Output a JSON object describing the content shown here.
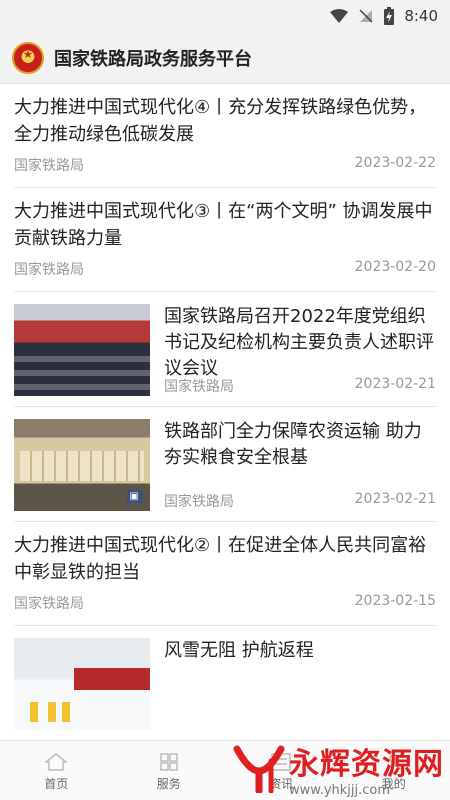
{
  "status": {
    "time": "8:40"
  },
  "app": {
    "title": "国家铁路局政务服务平台"
  },
  "articles": [
    {
      "title": "大力推进中国式现代化④丨充分发挥铁路绿色优势，全力推动绿色低碳发展",
      "source": "国家铁路局",
      "date": "2023-02-22"
    },
    {
      "title": "大力推进中国式现代化③丨在“两个文明” 协调发展中贡献铁路力量",
      "source": "国家铁路局",
      "date": "2023-02-20"
    },
    {
      "title": "国家铁路局召开2022年度党组织书记及纪检机构主要负责人述职评议会议",
      "source": "国家铁路局",
      "date": "2023-02-21"
    },
    {
      "title": "铁路部门全力保障农资运输 助力夯实粮食安全根基",
      "source": "国家铁路局",
      "date": "2023-02-21"
    },
    {
      "title": "大力推进中国式现代化②丨在促进全体人民共同富裕中彰显铁的担当",
      "source": "国家铁路局",
      "date": "2023-02-15"
    },
    {
      "title": "风雪无阻 护航返程",
      "source": "",
      "date": ""
    }
  ],
  "tabs": [
    {
      "label": "首页"
    },
    {
      "label": "服务"
    },
    {
      "label": "资讯"
    },
    {
      "label": "我的"
    }
  ],
  "watermark": {
    "name": "永辉资源网",
    "url": "www.yhkjjj.com"
  },
  "colors": {
    "accent": "#e02020",
    "meta": "#999999"
  }
}
